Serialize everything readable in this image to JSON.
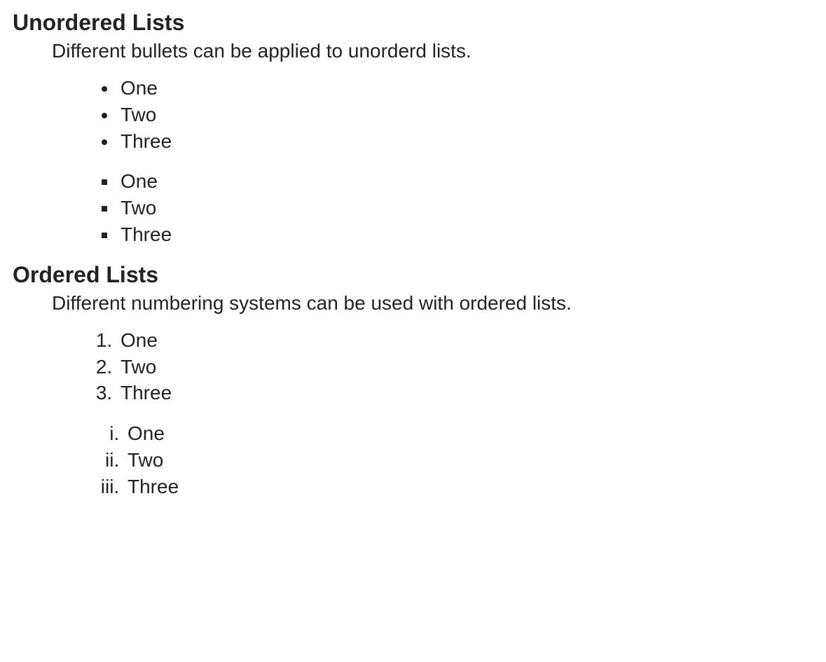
{
  "unordered": {
    "heading": "Unordered Lists",
    "description": "Different bullets can be applied to unorderd lists.",
    "lists": [
      {
        "style": "disc",
        "items": [
          "One",
          "Two",
          "Three"
        ]
      },
      {
        "style": "square",
        "items": [
          "One",
          "Two",
          "Three"
        ]
      }
    ]
  },
  "ordered": {
    "heading": "Ordered Lists",
    "description": "Different numbering systems can be used with ordered lists.",
    "lists": [
      {
        "style": "decimal",
        "items": [
          "One",
          "Two",
          "Three"
        ]
      },
      {
        "style": "roman",
        "items": [
          "One",
          "Two",
          "Three"
        ]
      }
    ]
  }
}
